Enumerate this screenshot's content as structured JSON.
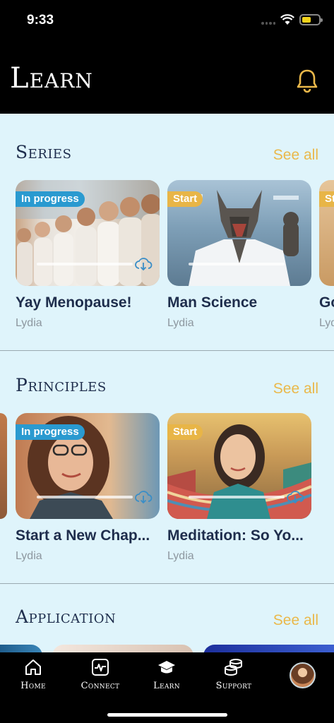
{
  "status_bar": {
    "time": "9:33"
  },
  "header": {
    "title": "Learn"
  },
  "sections": [
    {
      "title": "Series",
      "see_all": "See all",
      "cards": [
        {
          "badge": "In progress",
          "title": "Yay Menopause!",
          "author": "Lydia"
        },
        {
          "badge": "Start",
          "title": "Man Science",
          "author": "Lydia"
        },
        {
          "badge": "St",
          "title": "Go",
          "author": "Lyd"
        }
      ]
    },
    {
      "title": "Principles",
      "see_all": "See all",
      "cards": [
        {
          "badge": "In progress",
          "title": "Start a New Chap...",
          "author": "Lydia"
        },
        {
          "badge": "Start",
          "title": "Meditation: So Yo...",
          "author": "Lydia"
        }
      ]
    },
    {
      "title": "Application",
      "see_all": "See all"
    }
  ],
  "tabs": [
    {
      "label": "Home",
      "icon": "home-icon"
    },
    {
      "label": "Connect",
      "icon": "activity-icon"
    },
    {
      "label": "Learn",
      "icon": "graduation-cap-icon"
    },
    {
      "label": "Support",
      "icon": "coins-icon"
    }
  ],
  "colors": {
    "accent": "#eab84a",
    "badge_progress": "#2a9ad0",
    "badge_start": "#e8b547",
    "background": "#dff4fb",
    "title": "#1e2d4c"
  }
}
